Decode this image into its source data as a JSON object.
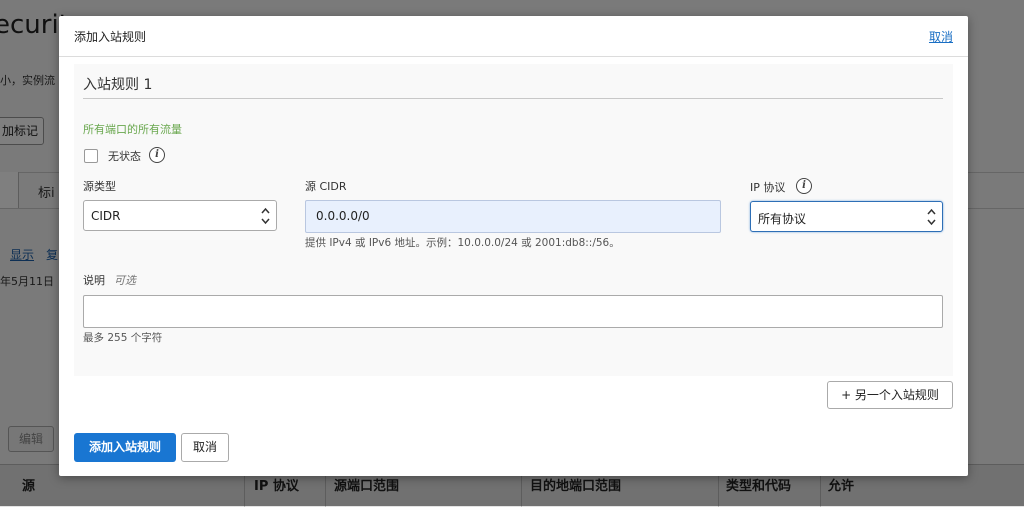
{
  "background": {
    "page_title": "ecurit",
    "subtitle": "小，实例流",
    "add_tag_button": "加标记",
    "tab_label": "标i",
    "show_link": "显示",
    "copy_link": "复",
    "date_text": "年5月11日",
    "edit_button": "编辑",
    "table_headers": [
      "源",
      "IP 协议",
      "源端口范围",
      "目的地端口范围",
      "类型和代码",
      "允许"
    ]
  },
  "modal": {
    "title": "添加入站规则",
    "cancel_link": "取消",
    "rule": {
      "heading": "入站规则 1",
      "traffic_note": "所有端口的所有流量",
      "stateless_label": "无状态",
      "source_type": {
        "label": "源类型",
        "value": "CIDR"
      },
      "source_cidr": {
        "label": "源 CIDR",
        "value": "0.0.0.0/0",
        "hint": "提供 IPv4 或 IPv6 地址。示例：10.0.0.0/24 或 2001:db8::/56。"
      },
      "ip_protocol": {
        "label": "IP 协议",
        "value": "所有协议"
      },
      "description": {
        "label": "说明",
        "optional": "可选",
        "value": "",
        "hint": "最多 255 个字符"
      }
    },
    "another_rule_button": "+ 另一个入站规则",
    "add_button": "添加入站规则",
    "cancel_button": "取消"
  },
  "colors": {
    "primary": "#1976d2",
    "link": "#1a6fc4",
    "note_green": "#6aa84f",
    "focus_border": "#2e6fb6"
  }
}
